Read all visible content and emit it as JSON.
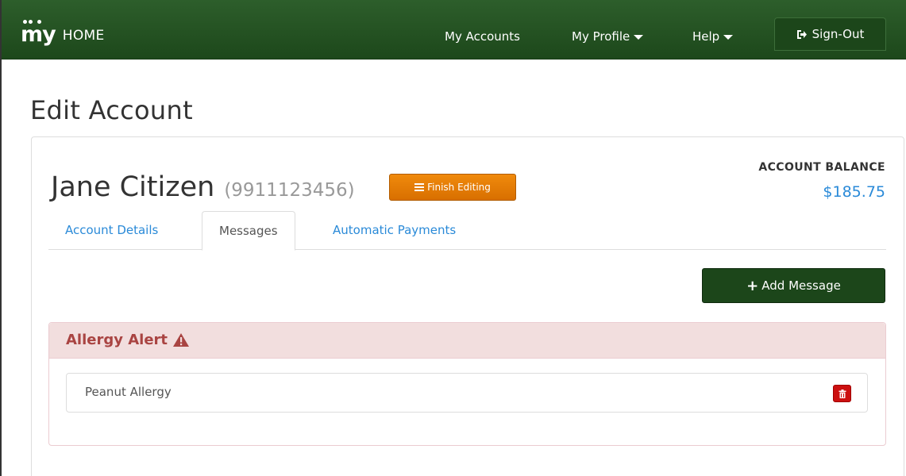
{
  "navbar": {
    "brand_logo": "my",
    "brand_text": "HOME",
    "items": [
      {
        "label": "My Accounts"
      },
      {
        "label": "My Profile"
      },
      {
        "label": "Help"
      }
    ],
    "signout_label": "Sign-Out",
    "background_color": "#1d481b"
  },
  "page": {
    "title": "Edit Account"
  },
  "account": {
    "name": "Jane Citizen",
    "id_display": "(9911123456)",
    "finish_editing_label": "Finish Editing",
    "balance_label": "ACCOUNT BALANCE",
    "balance_value": "$185.75"
  },
  "tabs": [
    {
      "label": "Account Details",
      "active": false
    },
    {
      "label": "Messages",
      "active": true
    },
    {
      "label": "Automatic Payments",
      "active": false
    }
  ],
  "actions": {
    "add_message_label": "Add Message"
  },
  "alert": {
    "title": "Allergy Alert",
    "icon": "warning-icon",
    "messages": [
      {
        "text": "Peanut Allergy",
        "action_icon": "trash-icon"
      }
    ]
  },
  "colors": {
    "accent": "#2a8ad8",
    "finish_button": "#e07a05",
    "add_button": "#1c461a",
    "alert_heading_bg": "#f2dede",
    "alert_heading_text": "#a94442",
    "delete_button": "#cc1010"
  }
}
